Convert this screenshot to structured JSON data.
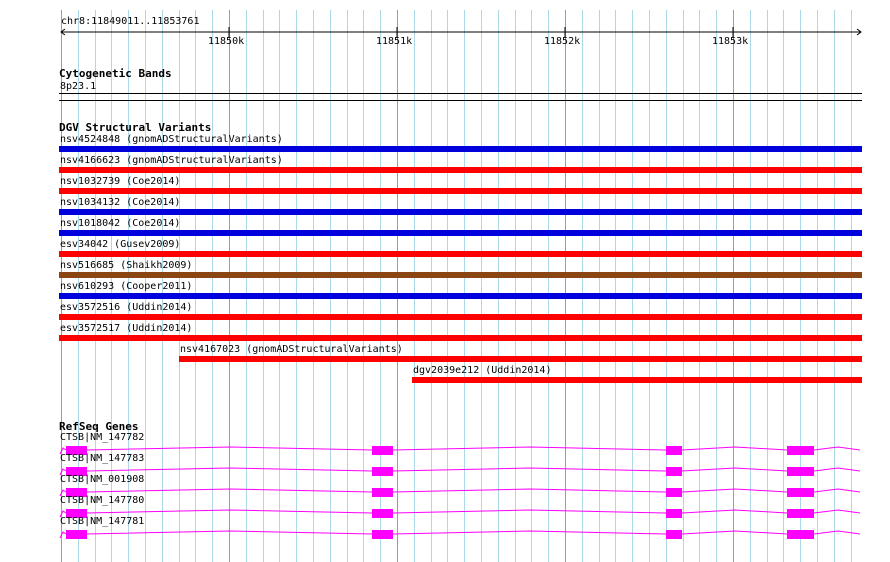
{
  "window": {
    "locus": "chr8:11849011..11853761",
    "ruler_ticks": [
      "11850k",
      "11851k",
      "11852k",
      "11853k"
    ]
  },
  "tracks": {
    "cytobands": {
      "title": "Cytogenetic Bands",
      "band": "8p23.1"
    },
    "dgv": {
      "title": "DGV Structural Variants",
      "variants": [
        {
          "label": "nsv4524848 (gnomADStructuralVariants)",
          "color": "#0000dd",
          "span": [
            0.0,
            1.0
          ]
        },
        {
          "label": "nsv4166623 (gnomADStructuralVariants)",
          "color": "#ff0000",
          "span": [
            0.0,
            1.0
          ]
        },
        {
          "label": "nsv1032739 (Coe2014)",
          "color": "#ff0000",
          "span": [
            0.0,
            1.0
          ]
        },
        {
          "label": "nsv1034132 (Coe2014)",
          "color": "#0000dd",
          "span": [
            0.0,
            1.0
          ]
        },
        {
          "label": "nsv1018042 (Coe2014)",
          "color": "#0000dd",
          "span": [
            0.0,
            1.0
          ]
        },
        {
          "label": "esv34042 (Gusev2009)",
          "color": "#ff0000",
          "span": [
            0.0,
            1.0
          ]
        },
        {
          "label": "nsv516685 (Shaikh2009)",
          "color": "#8b4513",
          "span": [
            0.0,
            1.0
          ]
        },
        {
          "label": "nsv610293 (Cooper2011)",
          "color": "#0000dd",
          "span": [
            0.0,
            1.0
          ]
        },
        {
          "label": "esv3572516 (Uddin2014)",
          "color": "#ff0000",
          "span": [
            0.0,
            1.0
          ]
        },
        {
          "label": "esv3572517 (Uddin2014)",
          "color": "#ff0000",
          "span": [
            0.0,
            1.0
          ]
        },
        {
          "label": "nsv4167023 (gnomADStructuralVariants)",
          "color": "#ff0000",
          "span": [
            0.15,
            1.0
          ]
        },
        {
          "label": "dgv2039e212 (Uddin2014)",
          "color": "#ff0000",
          "span": [
            0.44,
            1.0
          ]
        }
      ]
    },
    "refseq": {
      "title": "RefSeq Genes",
      "color": "#ff00ff",
      "transcripts": [
        {
          "label": "CTSB|NM_147782"
        },
        {
          "label": "CTSB|NM_147783"
        },
        {
          "label": "CTSB|NM_001908"
        },
        {
          "label": "CTSB|NM_147780"
        },
        {
          "label": "CTSB|NM_147781"
        }
      ]
    }
  },
  "colors": {
    "grid_line": "#add8e6",
    "grid_line_major": "#6fa8c8",
    "gene": "#ff00ff"
  }
}
